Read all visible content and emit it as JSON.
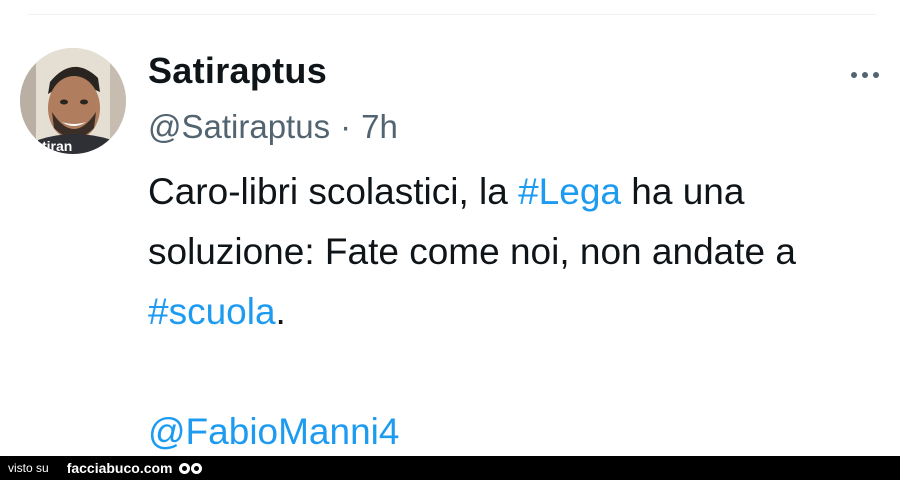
{
  "tweet": {
    "display_name": "Satiraptus",
    "handle": "@Satiraptus",
    "separator": "·",
    "time": "7h",
    "avatar_label": "tiran",
    "body": {
      "line1_pre": "Caro-libri scolastici, la ",
      "line1_hashtag": "#Lega",
      "line1_post": " ha una",
      "line2": "soluzione: Fate come noi, non andate a",
      "line3_hashtag": "#scuola",
      "line3_post": ".",
      "mention": "@FabioManni4"
    },
    "more_icon": "more-horizontal-icon"
  },
  "footer": {
    "prefix": "visto su",
    "brand": "facciabuco.com"
  },
  "colors": {
    "link": "#1d9bf0",
    "secondary_text": "#536471",
    "primary_text": "#0f1419",
    "footer_bg": "#000000"
  }
}
